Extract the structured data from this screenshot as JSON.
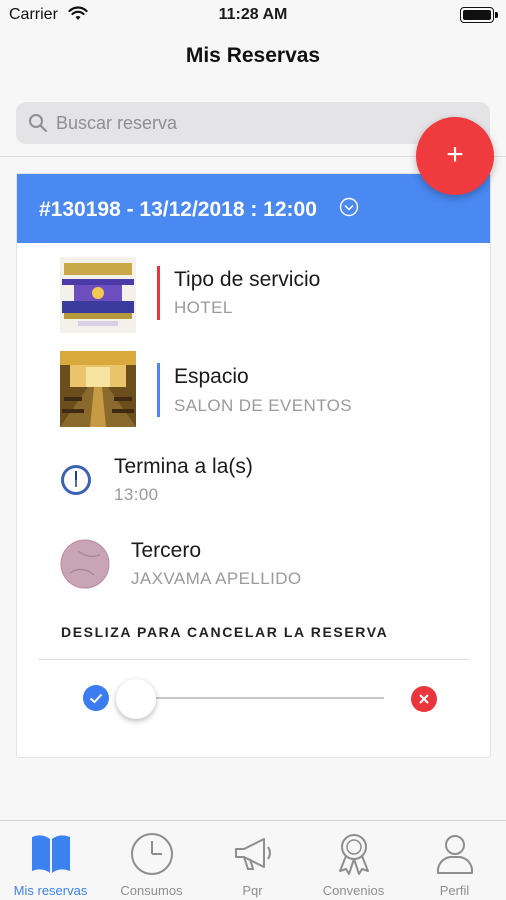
{
  "status_bar": {
    "carrier": "Carrier",
    "time": "11:28 AM"
  },
  "nav": {
    "title": "Mis Reservas"
  },
  "search": {
    "placeholder": "Buscar reserva",
    "value": ""
  },
  "fab": {
    "label": "+"
  },
  "reservation": {
    "header": "#130198 - 13/12/2018 : 12:00",
    "service": {
      "title": "Tipo de servicio",
      "value": "HOTEL",
      "accent": "#e8363c"
    },
    "space": {
      "title": "Espacio",
      "value": "SALON DE EVENTOS",
      "accent": "#4a88f2"
    },
    "end_time": {
      "title": "Termina a la(s)",
      "value": "13:00"
    },
    "third_party": {
      "title": "Tercero",
      "value": "JAXVAMA APELLIDO"
    },
    "cancel_hint": "DESLIZA PARA CANCELAR LA RESERVA",
    "slider_position": 0
  },
  "tabs": [
    {
      "label": "Mis reservas",
      "icon": "book-icon",
      "active": true
    },
    {
      "label": "Consumos",
      "icon": "clock-icon",
      "active": false
    },
    {
      "label": "Pqr",
      "icon": "megaphone-icon",
      "active": false
    },
    {
      "label": "Convenios",
      "icon": "award-icon",
      "active": false
    },
    {
      "label": "Perfil",
      "icon": "person-icon",
      "active": false
    }
  ],
  "colors": {
    "primary": "#4a88f2",
    "danger": "#ef3b3e",
    "tab_active": "#3b82f0",
    "tab_inactive": "#8e8e8e"
  }
}
